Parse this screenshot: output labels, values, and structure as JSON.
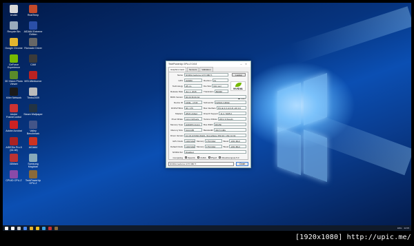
{
  "desktop_icons": [
    {
      "label": "lendini",
      "color": "#d8d8d8"
    },
    {
      "label": "RealTemp",
      "color": "#c44a2a"
    },
    {
      "label": "Recycle Bin",
      "color": "#9ab"
    },
    {
      "label": "AIDA64 Extreme Edition",
      "color": "#2a4fa8"
    },
    {
      "label": "Google Chrome",
      "color": "#e3b52e"
    },
    {
      "label": "Riomaxle Driver",
      "color": "#666"
    },
    {
      "label": "GeForce Experience",
      "color": "#76b900"
    },
    {
      "label": "CAM",
      "color": "#3a3a3a"
    },
    {
      "label": "3D Vision Photo Viewer",
      "color": "#5a8a2a"
    },
    {
      "label": "MSI Afterburner",
      "color": "#b22"
    },
    {
      "label": "Killer Network",
      "color": "#1a1a1a"
    },
    {
      "label": "Timbo2009",
      "color": "#bbb"
    },
    {
      "label": "Adobe FrameControl",
      "color": "#c33"
    },
    {
      "label": "Steam Wallpaper",
      "color": "#234"
    },
    {
      "label": "Adobe Acrobat",
      "color": "#c22"
    },
    {
      "label": "Valley Benchmark",
      "color": "#458"
    },
    {
      "label": "AIDESin Pro 8 (64-bit)",
      "color": "#a22"
    },
    {
      "label": "AIDA64",
      "color": "#c32"
    },
    {
      "label": "3DMark",
      "color": "#b33"
    },
    {
      "label": "Samsung Magician",
      "color": "#8ab"
    },
    {
      "label": "CPUID CPU-Z",
      "color": "#8a4aa8"
    },
    {
      "label": "TechPowerUp GPU-Z",
      "color": "#8a6a3a"
    }
  ],
  "gpuz": {
    "title": "TechPowerUp GPU-Z 0.8.8",
    "tabs": [
      "Graphics Card",
      "Sensors",
      "Validation"
    ],
    "lookup_label": "Lookup",
    "logo_text": "NVIDIA",
    "uefi_label": "UEFI",
    "rows": [
      {
        "label": "Name",
        "value": "NVIDIA GeForce GTX 980 Ti"
      },
      {
        "label": "GPU",
        "value": "GM200",
        "sub_label": "Revision",
        "sub_value": "A1"
      },
      {
        "label": "Technology",
        "value": "28 nm",
        "sub_label": "Die Size",
        "sub_value": "601 mm²"
      },
      {
        "label": "Release Date",
        "value": "Jun 1, 2015",
        "sub_label": "Transistors",
        "sub_value": "8000M"
      },
      {
        "label": "BIOS Version",
        "value": "84.00.36.00.A0"
      },
      {
        "label": "Device ID",
        "value": "10DE - 17C8",
        "sub_label": "Subvendor",
        "sub_value": "NVIDIA (10DE)"
      },
      {
        "label": "ROPs/TMUs",
        "value": "96 / 176",
        "sub_label": "Bus Interface",
        "sub_value": "PCI-E 3.0 x16 @ x16 3.0"
      },
      {
        "label": "Shaders",
        "value": "2816 Unified",
        "sub_label": "DirectX Support",
        "sub_value": "11.2 / SM5.0"
      },
      {
        "label": "Pixel Fillrate",
        "value": "114.2 GPixel/s",
        "sub_label": "Texture Fillrate",
        "sub_value": "209.4 GTexel/s"
      },
      {
        "label": "Memory Type",
        "value": "GDDR5 (Hynix)",
        "sub_label": "Bus Width",
        "sub_value": "384 Bit"
      },
      {
        "label": "Memory Size",
        "value": "6144 MB",
        "sub_label": "Bandwidth",
        "sub_value": "336.5 GB/s"
      },
      {
        "label": "Driver Version",
        "value": "10.18.13.5362 WHQL (ForceWare 353.62) / Win 10 64"
      },
      {
        "label": "GPU Clock",
        "value": "1190 MHz",
        "sub_label": "Memory",
        "sub_value": "1753 MHz",
        "sub2_label": "Boost",
        "sub2_value": "1291 MHz"
      },
      {
        "label": "Default Clock",
        "value": "1190 MHz",
        "sub_label": "Memory",
        "sub_value": "1753 MHz",
        "sub2_label": "Boost",
        "sub2_value": "1291 MHz"
      },
      {
        "label": "NVIDIA SLI",
        "value": "Disabled"
      }
    ],
    "computing_label": "Computing",
    "computing_items": [
      "OpenCL",
      "CUDA",
      "PhysX",
      "DirectCompute 5.0"
    ],
    "gpu_select": "NVIDIA GeForce GTX 980 Ti",
    "close_label": "Close"
  },
  "taskbar": {
    "icon_colors": [
      "#ffffff",
      "#cccccc",
      "#4a8af0",
      "#e6b22e",
      "#f0c020",
      "#3aa0e0",
      "#c83030",
      "#8a6a3a"
    ],
    "language": "ENG",
    "time": "22:05"
  },
  "watermark": "[1920x1080] http://upic.me/"
}
